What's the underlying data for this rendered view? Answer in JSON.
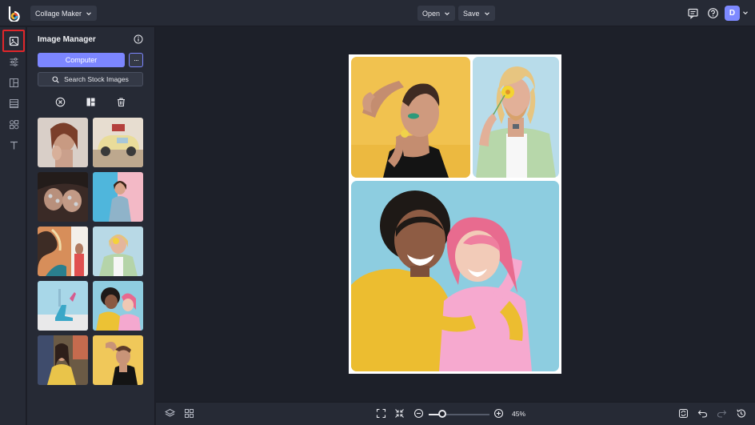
{
  "topbar": {
    "app_mode": "Collage Maker",
    "open_label": "Open",
    "save_label": "Save",
    "avatar_initial": "D"
  },
  "rail": {
    "items": [
      "image-manager",
      "adjustments",
      "layouts",
      "backgrounds",
      "graphics",
      "text"
    ],
    "active": "image-manager",
    "highlight_color": "#e0262a"
  },
  "panel": {
    "title": "Image Manager",
    "computer_button": "Computer",
    "more_button": "···",
    "stock_button": "Search Stock Images",
    "thumbnails_count": 10
  },
  "bottombar": {
    "zoom_value": "45%",
    "zoom_fraction": 0.22
  },
  "colors": {
    "accent": "#7c86ff",
    "background": "#1d2029",
    "panel": "#262a35"
  }
}
